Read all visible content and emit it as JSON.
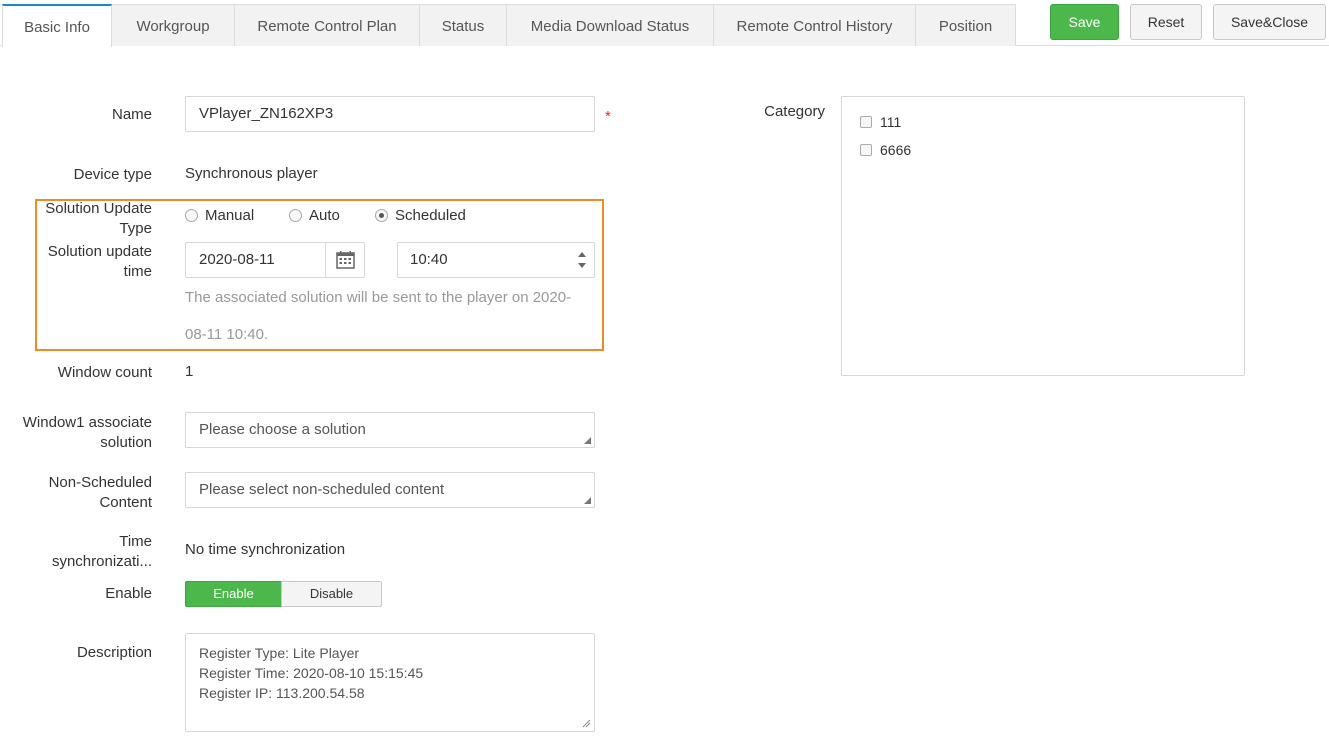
{
  "tabs": [
    {
      "label": "Basic Info",
      "active": true
    },
    {
      "label": "Workgroup"
    },
    {
      "label": "Remote Control Plan"
    },
    {
      "label": "Status"
    },
    {
      "label": "Media Download Status"
    },
    {
      "label": "Remote Control History"
    },
    {
      "label": "Position"
    }
  ],
  "actions": {
    "save": "Save",
    "reset": "Reset",
    "save_close": "Save&Close"
  },
  "form": {
    "name_label": "Name",
    "name_value": "VPlayer_ZN162XP3",
    "required_mark": "*",
    "device_type_label": "Device type",
    "device_type_value": "Synchronous player",
    "update_type_label_1": "Solution Update",
    "update_type_label_2": "Type",
    "update_type_options": [
      "Manual",
      "Auto",
      "Scheduled"
    ],
    "update_type_selected": "Scheduled",
    "update_time_label_1": "Solution update",
    "update_time_label_2": "time",
    "update_date": "2020-08-11",
    "update_time": "10:40",
    "hint_line_1": "The associated solution will be sent to the player on 2020-",
    "hint_line_2": "08-11 10:40.",
    "window_count_label": "Window count",
    "window_count_value": "1",
    "window1_label_1": "Window1 associate",
    "window1_label_2": "solution",
    "window1_placeholder": "Please choose a solution",
    "nonsched_label_1": "Non-Scheduled",
    "nonsched_label_2": "Content",
    "nonsched_placeholder": "Please select non-scheduled content",
    "timesync_label_1": "Time",
    "timesync_label_2": "synchronizati...",
    "timesync_value": "No time synchronization",
    "enable_label": "Enable",
    "enable_on": "Enable",
    "enable_off": "Disable",
    "description_label": "Description",
    "description_lines": [
      "Register Type: Lite Player",
      "Register Time: 2020-08-10 15:15:45",
      "Register IP: 113.200.54.58"
    ]
  },
  "category": {
    "label": "Category",
    "items": [
      "111",
      "6666"
    ]
  },
  "colors": {
    "accent_tab": "#1e88c8",
    "save_green": "#4cb84c",
    "highlight": "#f08a24",
    "required": "#d9302c"
  }
}
